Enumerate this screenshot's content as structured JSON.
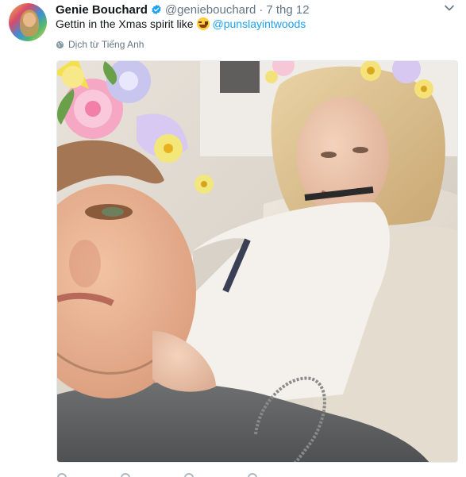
{
  "tweet": {
    "author": {
      "display_name": "Genie Bouchard",
      "handle": "@geniebouchard",
      "verified_icon": "verified-badge-icon",
      "avatar_icon": "profile-avatar"
    },
    "separator": "·",
    "timestamp": "7 thg 12",
    "menu_icon": "chevron-down-icon",
    "text_before": "Gettin in the Xmas spirit like",
    "emoji": "face-with-tears-of-joy-emoji",
    "mention": "@punslayintwoods",
    "translate_label": "Dịch từ Tiếng Anh",
    "translate_icon": "globe-icon",
    "photo_description_icon": "selfie-photo",
    "actions": [
      {
        "name": "reply-icon"
      },
      {
        "name": "retweet-icon"
      },
      {
        "name": "like-icon"
      },
      {
        "name": "dm-icon"
      }
    ],
    "colors": {
      "link": "#1da1f2",
      "muted": "#657786",
      "text": "#14171a",
      "verified": "#1da1f2"
    }
  }
}
